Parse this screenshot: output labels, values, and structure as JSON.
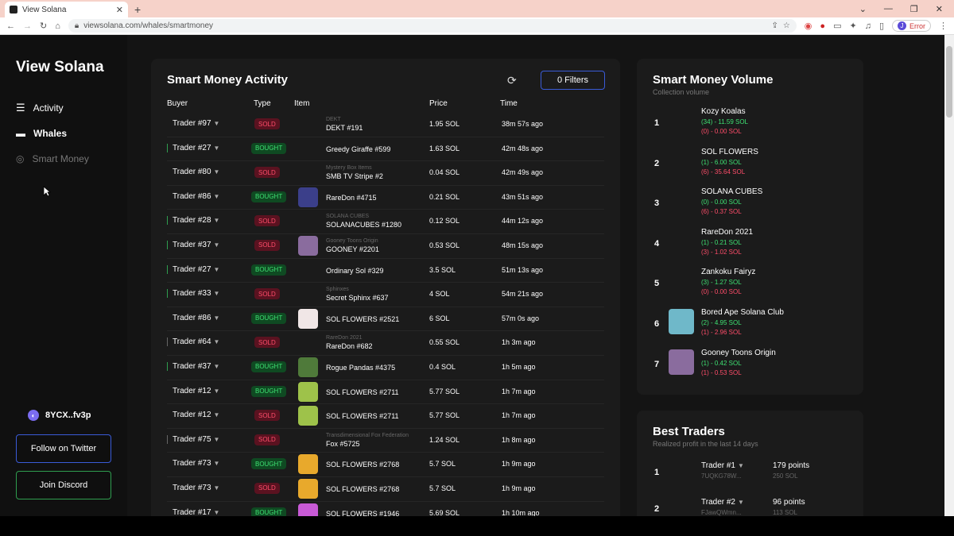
{
  "browser": {
    "tab_title": "View Solana",
    "url": "viewsolana.com/whales/smartmoney",
    "profile_label": "Error",
    "profile_initial": "J"
  },
  "sidebar": {
    "logo": "View Solana",
    "nav": [
      {
        "label": "Activity",
        "icon": "activity-icon"
      },
      {
        "label": "Whales",
        "icon": "whale-icon"
      },
      {
        "label": "Smart Money",
        "icon": "compass-icon"
      }
    ],
    "wallet": "8YCX..fv3p",
    "twitter_label": "Follow on Twitter",
    "discord_label": "Join Discord"
  },
  "activity": {
    "title": "Smart Money Activity",
    "filters_label": "0 Filters",
    "columns": {
      "buyer": "Buyer",
      "type": "Type",
      "item": "Item",
      "price": "Price",
      "time": "Time"
    },
    "rows": [
      {
        "trader": "Trader #97",
        "type": "SOLD",
        "collection": "DEKT",
        "item": "DEKT #191",
        "price": "1.95 SOL",
        "time": "38m 57s ago",
        "border": "n",
        "thumb": ""
      },
      {
        "trader": "Trader #27",
        "type": "BOUGHT",
        "collection": "",
        "item": "Greedy Giraffe #599",
        "price": "1.63 SOL",
        "time": "42m 48s ago",
        "border": "g",
        "thumb": ""
      },
      {
        "trader": "Trader #80",
        "type": "SOLD",
        "collection": "Mystery Box Items",
        "item": "SMB TV Stripe #2",
        "price": "0.04 SOL",
        "time": "42m 49s ago",
        "border": "n",
        "thumb": ""
      },
      {
        "trader": "Trader #86",
        "type": "BOUGHT",
        "collection": "",
        "item": "RareDon #4715",
        "price": "0.21 SOL",
        "time": "43m 51s ago",
        "border": "n",
        "thumb": "#3b3f8a"
      },
      {
        "trader": "Trader #28",
        "type": "SOLD",
        "collection": "SOLANA CUBES",
        "item": "SOLANACUBES #1280",
        "price": "0.12 SOL",
        "time": "44m 12s ago",
        "border": "g",
        "thumb": ""
      },
      {
        "trader": "Trader #37",
        "type": "SOLD",
        "collection": "Gooney Toons Origin",
        "item": "GOONEY #2201",
        "price": "0.53 SOL",
        "time": "48m 15s ago",
        "border": "g",
        "thumb": "#8a6c9e"
      },
      {
        "trader": "Trader #27",
        "type": "BOUGHT",
        "collection": "",
        "item": "Ordinary Sol #329",
        "price": "3.5 SOL",
        "time": "51m 13s ago",
        "border": "g",
        "thumb": ""
      },
      {
        "trader": "Trader #33",
        "type": "SOLD",
        "collection": "Sphinxes",
        "item": "Secret Sphinx #637",
        "price": "4 SOL",
        "time": "54m 21s ago",
        "border": "g",
        "thumb": ""
      },
      {
        "trader": "Trader #86",
        "type": "BOUGHT",
        "collection": "",
        "item": "SOL FLOWERS #2521",
        "price": "6 SOL",
        "time": "57m 0s ago",
        "border": "n",
        "thumb": "#f0e6e6"
      },
      {
        "trader": "Trader #64",
        "type": "SOLD",
        "collection": "RareDon 2021",
        "item": "RareDon #682",
        "price": "0.55 SOL",
        "time": "1h 3m ago",
        "border": "w",
        "thumb": ""
      },
      {
        "trader": "Trader #37",
        "type": "BOUGHT",
        "collection": "",
        "item": "Rogue Pandas #4375",
        "price": "0.4 SOL",
        "time": "1h 5m ago",
        "border": "g",
        "thumb": "#4f7a3a"
      },
      {
        "trader": "Trader #12",
        "type": "BOUGHT",
        "collection": "",
        "item": "SOL FLOWERS #2711",
        "price": "5.77 SOL",
        "time": "1h 7m ago",
        "border": "n",
        "thumb": "#9ec24a"
      },
      {
        "trader": "Trader #12",
        "type": "SOLD",
        "collection": "",
        "item": "SOL FLOWERS #2711",
        "price": "5.77 SOL",
        "time": "1h 7m ago",
        "border": "n",
        "thumb": "#9ec24a"
      },
      {
        "trader": "Trader #75",
        "type": "SOLD",
        "collection": "Transdimensional Fox Federation",
        "item": "Fox #5725",
        "price": "1.24 SOL",
        "time": "1h 8m ago",
        "border": "w",
        "thumb": ""
      },
      {
        "trader": "Trader #73",
        "type": "BOUGHT",
        "collection": "",
        "item": "SOL FLOWERS #2768",
        "price": "5.7 SOL",
        "time": "1h 9m ago",
        "border": "n",
        "thumb": "#e8a92c"
      },
      {
        "trader": "Trader #73",
        "type": "SOLD",
        "collection": "",
        "item": "SOL FLOWERS #2768",
        "price": "5.7 SOL",
        "time": "1h 9m ago",
        "border": "n",
        "thumb": "#e8a92c"
      },
      {
        "trader": "Trader #17",
        "type": "BOUGHT",
        "collection": "",
        "item": "SOL FLOWERS #1946",
        "price": "5.69 SOL",
        "time": "1h 10m ago",
        "border": "n",
        "thumb": "#c85ad6"
      }
    ]
  },
  "volume": {
    "title": "Smart Money Volume",
    "subtitle": "Collection volume",
    "rows": [
      {
        "rank": "1",
        "name": "Kozy Koalas",
        "bought": "(34) - 11.59 SOL",
        "sold": "(0) - 0.00 SOL",
        "thumb": ""
      },
      {
        "rank": "2",
        "name": "SOL FLOWERS",
        "bought": "(1) - 6.00 SOL",
        "sold": "(6) - 35.64 SOL",
        "thumb": ""
      },
      {
        "rank": "3",
        "name": "SOLANA CUBES",
        "bought": "(0) - 0.00 SOL",
        "sold": "(6) - 0.37 SOL",
        "thumb": ""
      },
      {
        "rank": "4",
        "name": "RareDon 2021",
        "bought": "(1) - 0.21 SOL",
        "sold": "(3) - 1.02 SOL",
        "thumb": ""
      },
      {
        "rank": "5",
        "name": "Zankoku Fairyz",
        "bought": "(3) - 1.27 SOL",
        "sold": "(0) - 0.00 SOL",
        "thumb": ""
      },
      {
        "rank": "6",
        "name": "Bored Ape Solana Club",
        "bought": "(2) - 4.95 SOL",
        "sold": "(1) - 2.96 SOL",
        "thumb": "#6fb8c9"
      },
      {
        "rank": "7",
        "name": "Gooney Toons Origin",
        "bought": "(1) - 0.42 SOL",
        "sold": "(1) - 0.53 SOL",
        "thumb": "#8a6c9e"
      }
    ]
  },
  "best": {
    "title": "Best Traders",
    "subtitle": "Realized profit in the last 14 days",
    "rows": [
      {
        "rank": "1",
        "name": "Trader #1",
        "addr": "7UQKG78W...",
        "points": "179 points",
        "sol": "250 SOL"
      },
      {
        "rank": "2",
        "name": "Trader #2",
        "addr": "FJawQWmn...",
        "points": "96 points",
        "sol": "113 SOL"
      }
    ]
  }
}
